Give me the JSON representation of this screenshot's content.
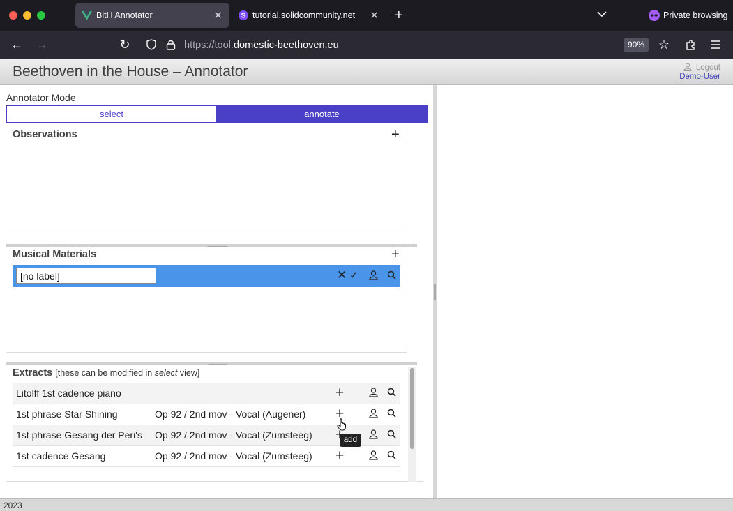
{
  "browser": {
    "tabs": [
      {
        "title": "BitH Annotator",
        "icon": "vue-logo-icon",
        "active": true
      },
      {
        "title": "tutorial.solidcommunity.net",
        "icon": "solid-logo-icon",
        "active": false
      }
    ],
    "private_label": "Private browsing",
    "url_prefix": "https://tool.",
    "url_domain": "domestic-beethoven.eu",
    "zoom": "90%"
  },
  "app": {
    "title": "Beethoven in the House – Annotator",
    "logout_label": "Logout",
    "user": "Demo-User"
  },
  "mode": {
    "label": "Annotator Mode",
    "options": [
      "select",
      "annotate"
    ],
    "active": "annotate"
  },
  "observations": {
    "title": "Observations"
  },
  "musical_materials": {
    "title": "Musical Materials",
    "edit_value": "[no label]"
  },
  "extracts": {
    "title": "Extracts",
    "note_prefix": "[these can be modified in ",
    "note_em": "select",
    "note_suffix": " view]",
    "rows": [
      {
        "name": "Litolff 1st cadence piano",
        "source": ""
      },
      {
        "name": "1st phrase Star Shining",
        "source": "Op 92 / 2nd mov - Vocal (Augener)"
      },
      {
        "name": "1st phrase Gesang der Peri's",
        "source": "Op 92 / 2nd mov - Vocal (Zumsteeg)"
      },
      {
        "name": "1st cadence Gesang",
        "source": "Op 92 / 2nd mov - Vocal (Zumsteeg)"
      }
    ]
  },
  "tooltip": "add",
  "footer": "2023",
  "colors": {
    "accent": "#4a3fc7",
    "selection": "#4a94ea"
  }
}
